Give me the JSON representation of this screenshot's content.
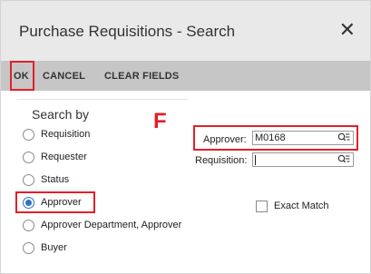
{
  "dialog": {
    "title": "Purchase Requisitions - Search",
    "close_symbol": "✕"
  },
  "toolbar": {
    "ok_label": "OK",
    "cancel_label": "CANCEL",
    "clear_label": "CLEAR FIELDS"
  },
  "annotation": {
    "letter": "F",
    "highlight_color": "#e0202a"
  },
  "search_by": {
    "heading": "Search by",
    "selected": "Approver",
    "options": [
      {
        "label": "Requisition",
        "checked": false
      },
      {
        "label": "Requester",
        "checked": false
      },
      {
        "label": "Status",
        "checked": false
      },
      {
        "label": "Approver",
        "checked": true
      },
      {
        "label": "Approver Department, Approver",
        "checked": false
      },
      {
        "label": "Buyer",
        "checked": false
      }
    ]
  },
  "fields": {
    "approver_label": "Approver:",
    "approver_value": "M0168",
    "requisition_label": "Requisition:",
    "requisition_value": "",
    "lookup_icon": "lookup-list-icon"
  },
  "exact_match": {
    "label": "Exact Match",
    "checked": false
  },
  "colors": {
    "accent": "#2f72c4",
    "toolbar_bg": "#c6c6c6",
    "titlebar_bg": "#e9e9e9"
  }
}
